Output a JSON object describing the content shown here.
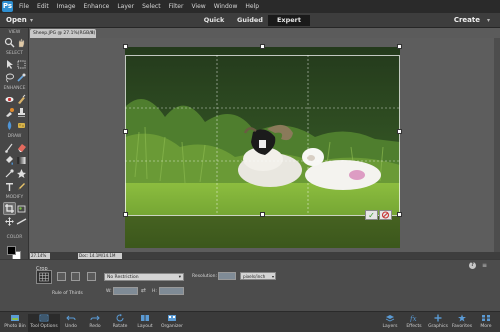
{
  "menubar": {
    "app_icon": "Ps",
    "items": [
      "File",
      "Edit",
      "Image",
      "Enhance",
      "Layer",
      "Select",
      "Filter",
      "View",
      "Window",
      "Help"
    ]
  },
  "modebar": {
    "open_label": "Open",
    "modes": [
      "Quick",
      "Guided",
      "Expert"
    ],
    "active_mode": "Expert",
    "create_label": "Create"
  },
  "toolbox": {
    "sections": [
      "VIEW",
      "SELECT",
      "ENHANCE",
      "DRAW",
      "MODIFY",
      "COLOR"
    ],
    "foreground_color": "#000000",
    "background_color": "#ffffff"
  },
  "document": {
    "tab_title": "Sheep.JPG @ 27.1%(RGB/8)",
    "zoom": "27.14%",
    "doc_info": "Doc: 14.1M/14.1M"
  },
  "tool_options": {
    "crop_label": "Crop",
    "preset_label": "Rule of Thirds",
    "ratio_dropdown": "No Restriction",
    "w_label": "W:",
    "h_label": "H:",
    "resolution_label": "Resolution:",
    "unit_dropdown": "pixels/inch"
  },
  "taskbar": {
    "left": [
      "Photo Bin",
      "Tool Options",
      "Undo",
      "Redo",
      "Rotate",
      "Layout",
      "Organizer"
    ],
    "right": [
      "Layers",
      "Effects",
      "Graphics",
      "Favorites",
      "More"
    ],
    "active": "Tool Options"
  },
  "colors": {
    "menubar_bg": "#2a2a2a",
    "accent_blue": "#2e8fd1",
    "commit_green": "#3b9d2c",
    "cancel_red": "#c83232"
  }
}
